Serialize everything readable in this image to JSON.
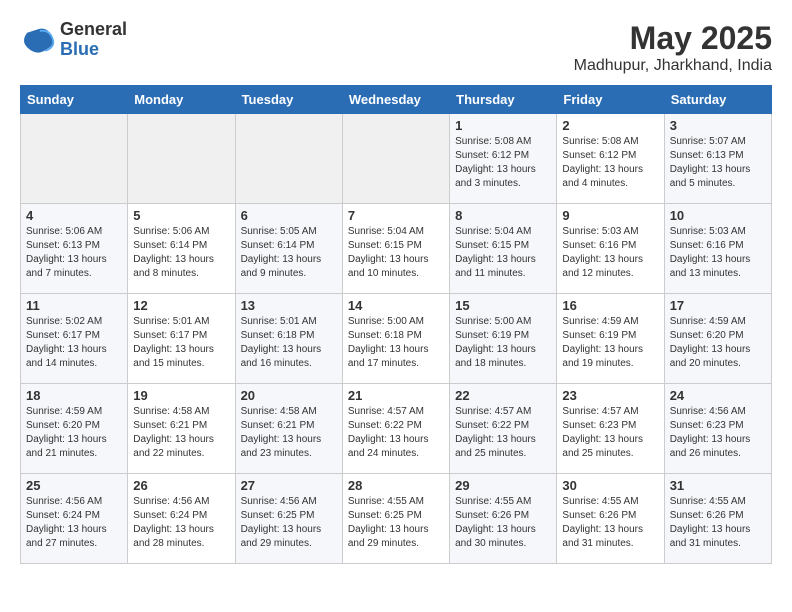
{
  "header": {
    "logo_general": "General",
    "logo_blue": "Blue",
    "month_year": "May 2025",
    "location": "Madhupur, Jharkhand, India"
  },
  "weekdays": [
    "Sunday",
    "Monday",
    "Tuesday",
    "Wednesday",
    "Thursday",
    "Friday",
    "Saturday"
  ],
  "weeks": [
    [
      {
        "day": "",
        "empty": true
      },
      {
        "day": "",
        "empty": true
      },
      {
        "day": "",
        "empty": true
      },
      {
        "day": "",
        "empty": true
      },
      {
        "day": "1",
        "sunrise": "5:08 AM",
        "sunset": "6:12 PM",
        "daylight": "13 hours and 3 minutes."
      },
      {
        "day": "2",
        "sunrise": "5:08 AM",
        "sunset": "6:12 PM",
        "daylight": "13 hours and 4 minutes."
      },
      {
        "day": "3",
        "sunrise": "5:07 AM",
        "sunset": "6:13 PM",
        "daylight": "13 hours and 5 minutes."
      }
    ],
    [
      {
        "day": "4",
        "sunrise": "5:06 AM",
        "sunset": "6:13 PM",
        "daylight": "13 hours and 7 minutes."
      },
      {
        "day": "5",
        "sunrise": "5:06 AM",
        "sunset": "6:14 PM",
        "daylight": "13 hours and 8 minutes."
      },
      {
        "day": "6",
        "sunrise": "5:05 AM",
        "sunset": "6:14 PM",
        "daylight": "13 hours and 9 minutes."
      },
      {
        "day": "7",
        "sunrise": "5:04 AM",
        "sunset": "6:15 PM",
        "daylight": "13 hours and 10 minutes."
      },
      {
        "day": "8",
        "sunrise": "5:04 AM",
        "sunset": "6:15 PM",
        "daylight": "13 hours and 11 minutes."
      },
      {
        "day": "9",
        "sunrise": "5:03 AM",
        "sunset": "6:16 PM",
        "daylight": "13 hours and 12 minutes."
      },
      {
        "day": "10",
        "sunrise": "5:03 AM",
        "sunset": "6:16 PM",
        "daylight": "13 hours and 13 minutes."
      }
    ],
    [
      {
        "day": "11",
        "sunrise": "5:02 AM",
        "sunset": "6:17 PM",
        "daylight": "13 hours and 14 minutes."
      },
      {
        "day": "12",
        "sunrise": "5:01 AM",
        "sunset": "6:17 PM",
        "daylight": "13 hours and 15 minutes."
      },
      {
        "day": "13",
        "sunrise": "5:01 AM",
        "sunset": "6:18 PM",
        "daylight": "13 hours and 16 minutes."
      },
      {
        "day": "14",
        "sunrise": "5:00 AM",
        "sunset": "6:18 PM",
        "daylight": "13 hours and 17 minutes."
      },
      {
        "day": "15",
        "sunrise": "5:00 AM",
        "sunset": "6:19 PM",
        "daylight": "13 hours and 18 minutes."
      },
      {
        "day": "16",
        "sunrise": "4:59 AM",
        "sunset": "6:19 PM",
        "daylight": "13 hours and 19 minutes."
      },
      {
        "day": "17",
        "sunrise": "4:59 AM",
        "sunset": "6:20 PM",
        "daylight": "13 hours and 20 minutes."
      }
    ],
    [
      {
        "day": "18",
        "sunrise": "4:59 AM",
        "sunset": "6:20 PM",
        "daylight": "13 hours and 21 minutes."
      },
      {
        "day": "19",
        "sunrise": "4:58 AM",
        "sunset": "6:21 PM",
        "daylight": "13 hours and 22 minutes."
      },
      {
        "day": "20",
        "sunrise": "4:58 AM",
        "sunset": "6:21 PM",
        "daylight": "13 hours and 23 minutes."
      },
      {
        "day": "21",
        "sunrise": "4:57 AM",
        "sunset": "6:22 PM",
        "daylight": "13 hours and 24 minutes."
      },
      {
        "day": "22",
        "sunrise": "4:57 AM",
        "sunset": "6:22 PM",
        "daylight": "13 hours and 25 minutes."
      },
      {
        "day": "23",
        "sunrise": "4:57 AM",
        "sunset": "6:23 PM",
        "daylight": "13 hours and 25 minutes."
      },
      {
        "day": "24",
        "sunrise": "4:56 AM",
        "sunset": "6:23 PM",
        "daylight": "13 hours and 26 minutes."
      }
    ],
    [
      {
        "day": "25",
        "sunrise": "4:56 AM",
        "sunset": "6:24 PM",
        "daylight": "13 hours and 27 minutes."
      },
      {
        "day": "26",
        "sunrise": "4:56 AM",
        "sunset": "6:24 PM",
        "daylight": "13 hours and 28 minutes."
      },
      {
        "day": "27",
        "sunrise": "4:56 AM",
        "sunset": "6:25 PM",
        "daylight": "13 hours and 29 minutes."
      },
      {
        "day": "28",
        "sunrise": "4:55 AM",
        "sunset": "6:25 PM",
        "daylight": "13 hours and 29 minutes."
      },
      {
        "day": "29",
        "sunrise": "4:55 AM",
        "sunset": "6:26 PM",
        "daylight": "13 hours and 30 minutes."
      },
      {
        "day": "30",
        "sunrise": "4:55 AM",
        "sunset": "6:26 PM",
        "daylight": "13 hours and 31 minutes."
      },
      {
        "day": "31",
        "sunrise": "4:55 AM",
        "sunset": "6:26 PM",
        "daylight": "13 hours and 31 minutes."
      }
    ]
  ],
  "labels": {
    "sunrise": "Sunrise:",
    "sunset": "Sunset:",
    "daylight": "Daylight:"
  }
}
